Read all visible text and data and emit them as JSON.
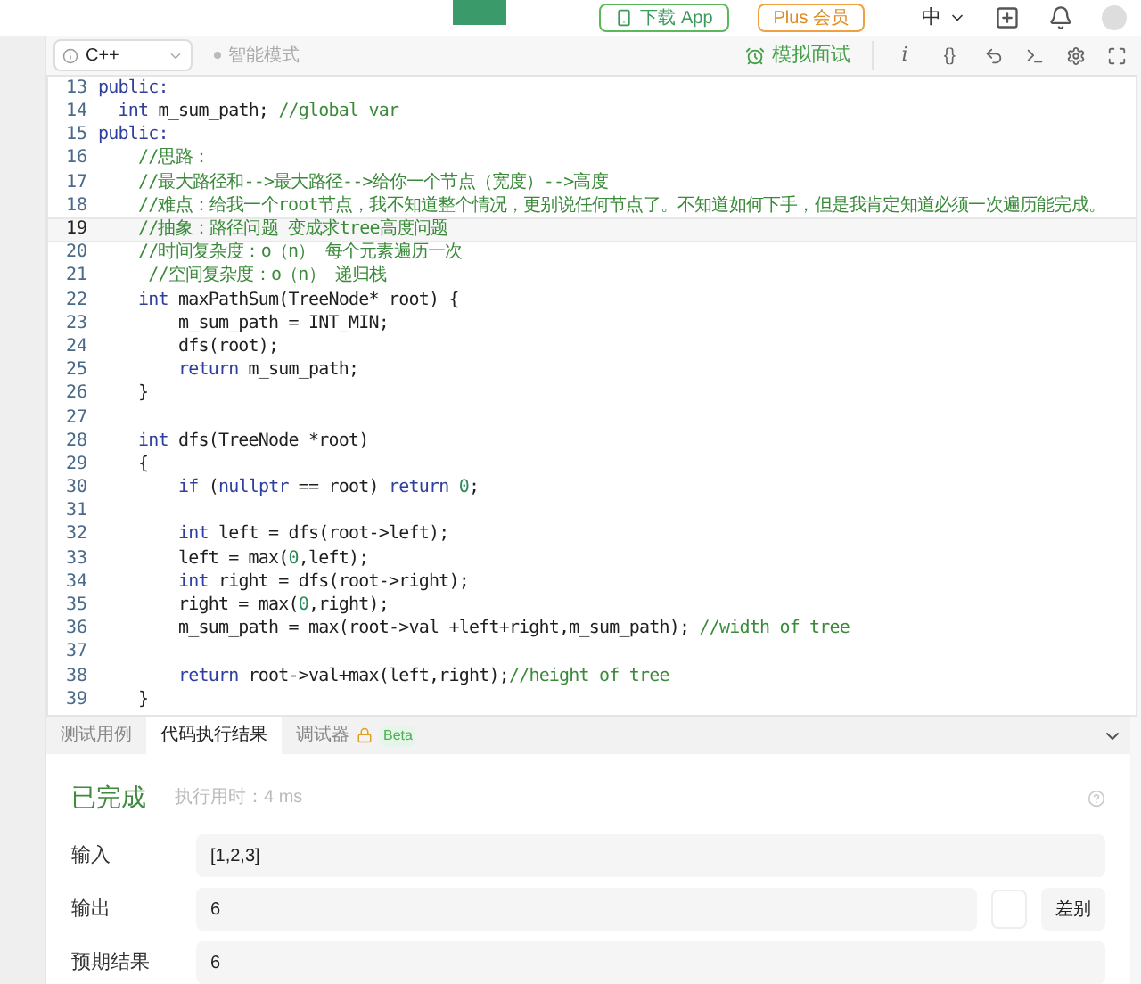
{
  "top_bar": {
    "download_button": "下载 App",
    "plus_button": "Plus 会员",
    "language": "中"
  },
  "toolbar": {
    "language_select": "C++",
    "smart_mode": "智能模式",
    "mock_interview": "模拟面试",
    "info_button": "i",
    "format_button": "{}"
  },
  "editor": {
    "lines": [
      {
        "number": "13",
        "current": false,
        "segments": [
          {
            "kind": "keyword",
            "text": "public:"
          }
        ]
      },
      {
        "number": "14",
        "current": false,
        "segments": [
          {
            "kind": "keyword",
            "text": "  int"
          },
          {
            "kind": "plain",
            "text": " m_sum_path; "
          },
          {
            "kind": "comment",
            "text": "//global var"
          }
        ]
      },
      {
        "number": "15",
        "current": false,
        "segments": [
          {
            "kind": "keyword",
            "text": "public:"
          }
        ]
      },
      {
        "number": "16",
        "current": false,
        "segments": [
          {
            "kind": "comment",
            "text": "    //思路："
          }
        ]
      },
      {
        "number": "17",
        "current": false,
        "segments": [
          {
            "kind": "comment",
            "text": "    //最大路径和-->最大路径-->给你一个节点（宽度）-->高度"
          }
        ]
      },
      {
        "number": "18",
        "current": false,
        "segments": [
          {
            "kind": "comment",
            "text": "    //难点：给我一个root节点，我不知道整个情况，更别说任何节点了。不知道如何下手，但是我肯定知道必须一次遍历能完成。"
          }
        ]
      },
      {
        "number": "19",
        "current": true,
        "segments": [
          {
            "kind": "comment",
            "text": "    //抽象：路径问题 变成求tree高度问题"
          }
        ]
      },
      {
        "number": "20",
        "current": false,
        "segments": [
          {
            "kind": "comment",
            "text": "    //时间复杂度：o（n） 每个元素遍历一次"
          }
        ]
      },
      {
        "number": "21",
        "current": false,
        "segments": [
          {
            "kind": "comment",
            "text": "     //空间复杂度：o（n） 递归栈"
          }
        ]
      },
      {
        "number": "22",
        "current": false,
        "segments": [
          {
            "kind": "keyword",
            "text": "    int"
          },
          {
            "kind": "plain",
            "text": " maxPathSum(TreeNode* root) {"
          }
        ]
      },
      {
        "number": "23",
        "current": false,
        "segments": [
          {
            "kind": "plain",
            "text": "        m_sum_path = INT_MIN;"
          }
        ]
      },
      {
        "number": "24",
        "current": false,
        "segments": [
          {
            "kind": "plain",
            "text": "        dfs(root);"
          }
        ]
      },
      {
        "number": "25",
        "current": false,
        "segments": [
          {
            "kind": "keyword",
            "text": "        return"
          },
          {
            "kind": "plain",
            "text": " m_sum_path;"
          }
        ]
      },
      {
        "number": "26",
        "current": false,
        "segments": [
          {
            "kind": "plain",
            "text": "    }"
          }
        ]
      },
      {
        "number": "27",
        "current": false
      },
      {
        "number": "28",
        "current": false,
        "segments": [
          {
            "kind": "keyword",
            "text": "    int"
          },
          {
            "kind": "plain",
            "text": " dfs(TreeNode *root)"
          }
        ]
      },
      {
        "number": "29",
        "current": false,
        "segments": [
          {
            "kind": "plain",
            "text": "    {"
          }
        ]
      },
      {
        "number": "30",
        "current": false,
        "segments": [
          {
            "kind": "keyword",
            "text": "        if"
          },
          {
            "kind": "plain",
            "text": " ("
          },
          {
            "kind": "keyword",
            "text": "nullptr"
          },
          {
            "kind": "plain",
            "text": " == root) "
          },
          {
            "kind": "keyword",
            "text": "return"
          },
          {
            "kind": "number",
            "text": " 0"
          },
          {
            "kind": "plain",
            "text": ";"
          }
        ]
      },
      {
        "number": "31",
        "current": false
      },
      {
        "number": "32",
        "current": false,
        "segments": [
          {
            "kind": "keyword",
            "text": "        int"
          },
          {
            "kind": "plain",
            "text": " left = dfs(root->left);"
          }
        ]
      },
      {
        "number": "33",
        "current": false,
        "segments": [
          {
            "kind": "plain",
            "text": "        left = max("
          },
          {
            "kind": "number",
            "text": "0"
          },
          {
            "kind": "plain",
            "text": ",left);"
          }
        ]
      },
      {
        "number": "34",
        "current": false,
        "segments": [
          {
            "kind": "keyword",
            "text": "        int"
          },
          {
            "kind": "plain",
            "text": " right = dfs(root->right);"
          }
        ]
      },
      {
        "number": "35",
        "current": false,
        "segments": [
          {
            "kind": "plain",
            "text": "        right = max("
          },
          {
            "kind": "number",
            "text": "0"
          },
          {
            "kind": "plain",
            "text": ",right);"
          }
        ]
      },
      {
        "number": "36",
        "current": false,
        "segments": [
          {
            "kind": "plain",
            "text": "        m_sum_path = max(root->val +left+right,m_sum_path); "
          },
          {
            "kind": "comment",
            "text": "//width of tree"
          }
        ]
      },
      {
        "number": "37",
        "current": false
      },
      {
        "number": "38",
        "current": false,
        "segments": [
          {
            "kind": "keyword",
            "text": "        return"
          },
          {
            "kind": "plain",
            "text": " root->val+max(left,right);"
          },
          {
            "kind": "comment",
            "text": "//height of tree"
          }
        ]
      },
      {
        "number": "39",
        "current": false,
        "segments": [
          {
            "kind": "plain",
            "text": "    }"
          }
        ]
      }
    ]
  },
  "result_tabs": [
    {
      "label": "测试用例",
      "selected": false
    },
    {
      "label": "代码执行结果",
      "selected": true
    },
    {
      "label": "调试器",
      "selected": false,
      "badge": "Beta"
    }
  ],
  "result": {
    "status": "已完成",
    "runtime": "执行用时：4 ms",
    "rows": [
      {
        "label": "输入",
        "value": "[1,2,3]"
      },
      {
        "label": "输出",
        "value": "6",
        "action": "差别"
      },
      {
        "label": "预期结果",
        "value": "6"
      }
    ]
  }
}
